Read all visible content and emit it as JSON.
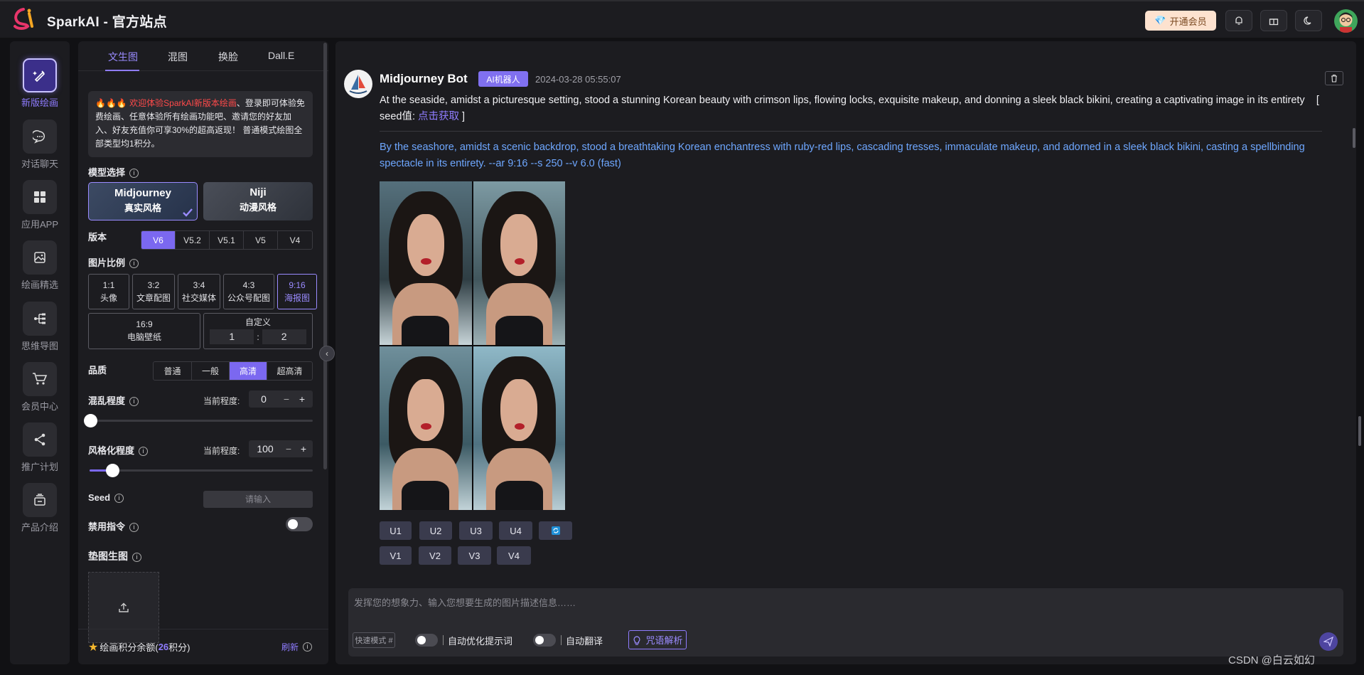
{
  "app": {
    "brand": "SparkAI - 官方站点",
    "vip_label": "开通会员"
  },
  "nav": {
    "items": [
      {
        "label": "新版绘画",
        "icon": "paint-brush-icon",
        "active": true
      },
      {
        "label": "对话聊天",
        "icon": "chat-bubble-icon"
      },
      {
        "label": "应用APP",
        "icon": "apps-grid-icon"
      },
      {
        "label": "绘画精选",
        "icon": "gallery-icon"
      },
      {
        "label": "思维导图",
        "icon": "mindmap-icon"
      },
      {
        "label": "会员中心",
        "icon": "cart-icon"
      },
      {
        "label": "推广计划",
        "icon": "share-icon"
      },
      {
        "label": "产品介绍",
        "icon": "product-icon"
      }
    ]
  },
  "panel": {
    "tabs": [
      "文生图",
      "混图",
      "换脸",
      "Dall.E"
    ],
    "notice_prefix": "🔥🔥🔥 ",
    "notice_highlight": "欢迎体验SparkAI新版本绘画",
    "notice_rest": "、登录即可体验免费绘画、任意体验所有绘画功能吧、邀请您的好友加入、好友充值你可享30%的超高返现！ 普通模式绘图全部类型均1积分。",
    "model_label": "模型选择",
    "models": [
      {
        "name": "Midjourney",
        "style": "真实风格",
        "selected": true
      },
      {
        "name": "Niji",
        "style": "动漫风格"
      }
    ],
    "version_label": "版本",
    "versions": [
      "V6",
      "V5.2",
      "V5.1",
      "V5",
      "V4"
    ],
    "ratio_label": "图片比例",
    "ratios": [
      {
        "value": "1:1",
        "desc": "头像"
      },
      {
        "value": "3:2",
        "desc": "文章配图"
      },
      {
        "value": "3:4",
        "desc": "社交媒体"
      },
      {
        "value": "4:3",
        "desc": "公众号配图"
      },
      {
        "value": "9:16",
        "desc": "海报图",
        "selected": true
      }
    ],
    "ratio_wide": {
      "value": "16:9",
      "desc": "电脑壁纸"
    },
    "ratio_custom": {
      "label": "自定义",
      "w": "1",
      "sep": ":",
      "h": "2"
    },
    "quality_label": "品质",
    "qualities": [
      "普通",
      "一般",
      "高清",
      "超高清"
    ],
    "chaos_label": "混乱程度",
    "current_label": "当前程度:",
    "chaos_value": "0",
    "chaos_level": 0,
    "stylize_label": "风格化程度",
    "stylize_value": "100",
    "stylize_level": 0.1,
    "seed_label": "Seed",
    "seed_placeholder": "请输入",
    "disable_label": "禁用指令",
    "ref_label": "垫图生图",
    "footer_label": "绘画积分余额(",
    "credits": "26",
    "credits_unit": "积分)",
    "refresh_label": "刷新"
  },
  "message": {
    "bot_name": "Midjourney Bot",
    "badge": "AI机器人",
    "time": "2024-03-28 05:55:07",
    "prompt": "At the seaside, amidst a picturesque setting, stood a stunning Korean beauty with crimson lips, flowing locks, exquisite makeup, and donning a sleek black bikini, creating a captivating image in its entirety",
    "seed_prefix": "[ seed值: ",
    "seed_link": "点击获取",
    "seed_suffix": " ]",
    "translation": "By the seashore, amidst a scenic backdrop, stood a breathtaking Korean enchantress with ruby-red lips, cascading tresses, immaculate makeup, and adorned in a sleek black bikini, casting a spellbinding spectacle in its entirety. --ar 9:16 --s 250 --v 6.0  (fast)",
    "upscale_buttons": [
      "U1",
      "U2",
      "U3",
      "U4"
    ],
    "variation_buttons": [
      "V1",
      "V2",
      "V3",
      "V4"
    ]
  },
  "composer": {
    "placeholder": "发挥您的想象力、输入您想要生成的图片描述信息……",
    "quick_mode": "快速模式 #",
    "auto_optimize": "自动优化提示词",
    "auto_translate": "自动翻译",
    "parse_label": "咒语解析"
  },
  "watermark": "CSDN @白云如幻",
  "colors": {
    "accent": "#7b68f0",
    "link": "#6ea7ff",
    "danger": "#ff4a4a"
  }
}
